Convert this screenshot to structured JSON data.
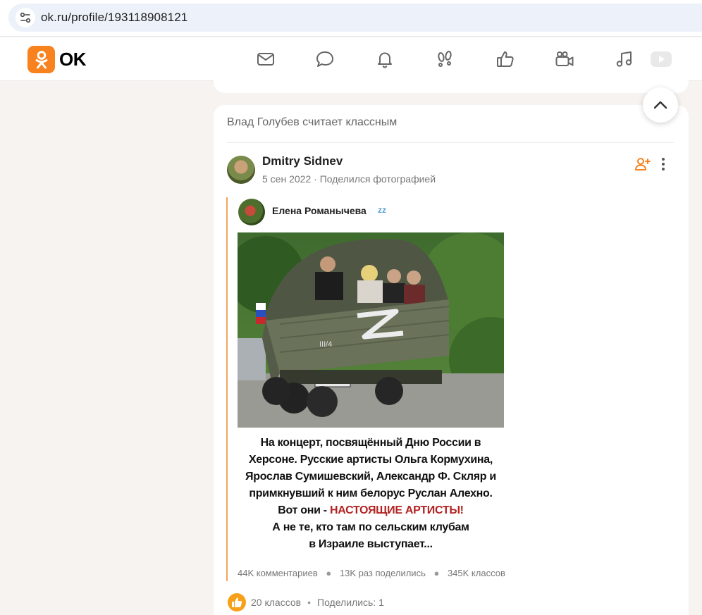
{
  "browser": {
    "url": "ok.ru/profile/193118908121"
  },
  "header": {
    "logo_text": "OK",
    "brand_color": "#f7821e",
    "nav_icons": [
      "mail-icon",
      "chat-icon",
      "bell-icon",
      "guests-icon",
      "like-icon",
      "video-camera-icon",
      "music-icon",
      "video-play-icon"
    ]
  },
  "feed": {
    "card_title": "Влад Голубев считает классным",
    "post": {
      "author": "Dmitry Sidnev",
      "date": "5 сен 2022",
      "action": "Поделился фотографией",
      "repost": {
        "author": "Елена Романычева",
        "badge": "zz",
        "caption_lines": [
          "На концерт, посвящённый Дню России в",
          "Херсоне. Русские артисты Ольга Кормухина,",
          "Ярослав Сумишевский, Александр Ф. Скляр и",
          "примкнувший к ним белорус Руслан Алехно.",
          "Вот они -",
          "НАСТОЯЩИЕ АРТИСТЫ!",
          "А не те, кто там по сельским клубам",
          "в Израиле выступает..."
        ],
        "stats": {
          "comments": "44K комментариев",
          "shares": "13K раз поделились",
          "classes": "345K классов"
        }
      },
      "likes": "20 классов",
      "shared": "Поделились: 1"
    }
  }
}
